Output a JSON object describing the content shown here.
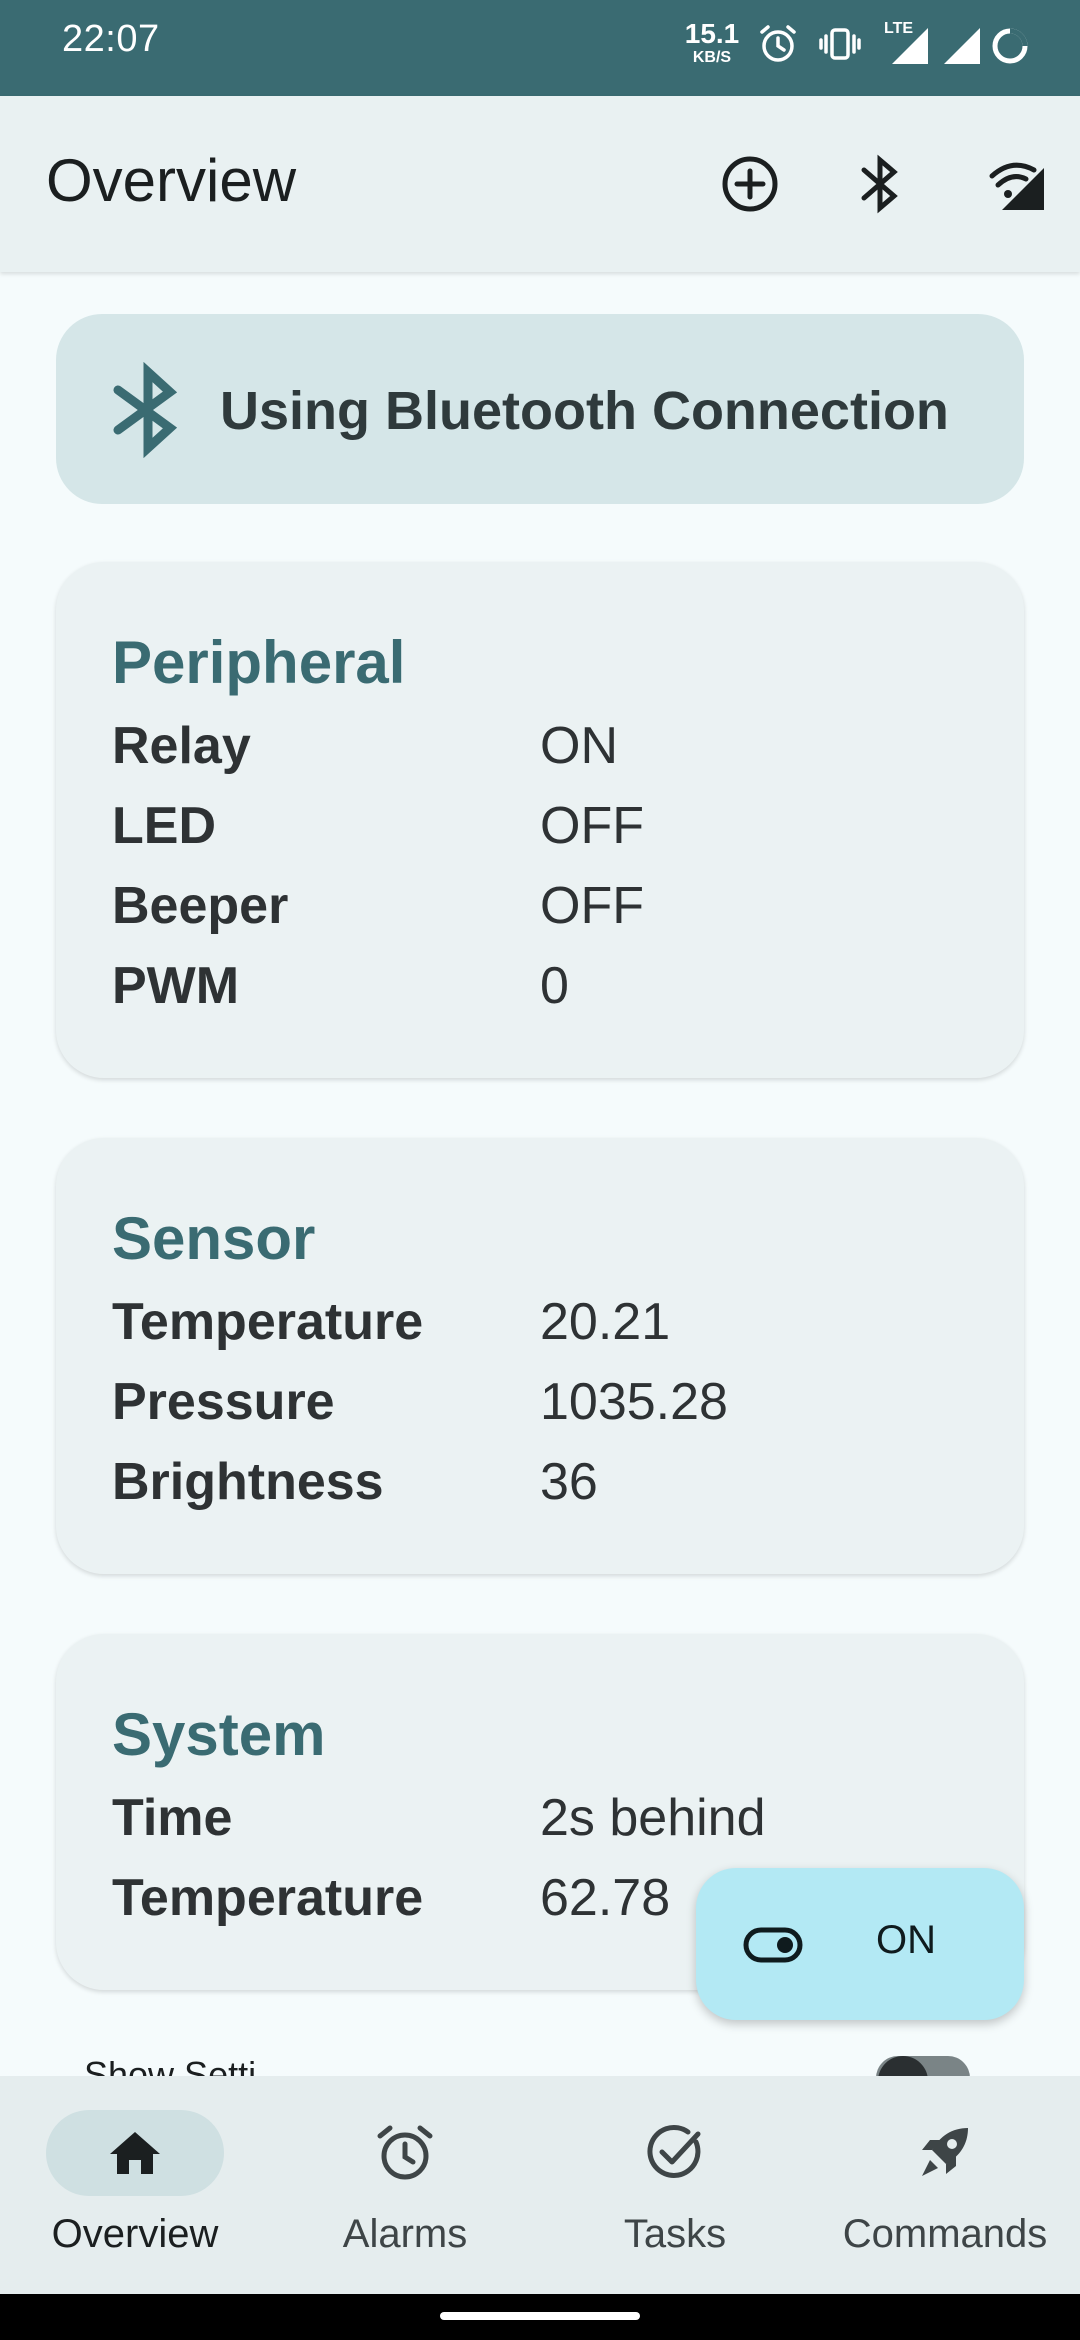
{
  "status_bar": {
    "time": "22:07",
    "speed_value": "15.1",
    "speed_unit": "KB/S",
    "network_label": "LTE"
  },
  "app_bar": {
    "title": "Overview",
    "actions": [
      "add-circle-icon",
      "bluetooth-icon",
      "wifi-signal-icon"
    ]
  },
  "banner": {
    "icon": "bluetooth-icon",
    "text": "Using Bluetooth Connection"
  },
  "peripheral": {
    "title": "Peripheral",
    "rows": [
      {
        "label": "Relay",
        "value": "ON"
      },
      {
        "label": "LED",
        "value": "OFF"
      },
      {
        "label": "Beeper",
        "value": "OFF"
      },
      {
        "label": "PWM",
        "value": "0"
      }
    ]
  },
  "sensor": {
    "title": "Sensor",
    "rows": [
      {
        "label": "Temperature",
        "value": "20.21"
      },
      {
        "label": "Pressure",
        "value": "1035.28"
      },
      {
        "label": "Brightness",
        "value": "36"
      }
    ]
  },
  "system": {
    "title": "System",
    "rows": [
      {
        "label": "Time",
        "value": "2s behind"
      },
      {
        "label": "Temperature",
        "value": "62.78"
      }
    ]
  },
  "settings_row": {
    "label": "Show Setti"
  },
  "fab": {
    "icon": "toggle-icon",
    "label": "ON"
  },
  "bottom_nav": {
    "items": [
      {
        "label": "Overview",
        "icon": "home-icon",
        "active": true
      },
      {
        "label": "Alarms",
        "icon": "alarm-icon",
        "active": false
      },
      {
        "label": "Tasks",
        "icon": "check-circle-icon",
        "active": false
      },
      {
        "label": "Commands",
        "icon": "rocket-icon",
        "active": false
      }
    ]
  },
  "colors": {
    "primary": "#3a6b72",
    "banner_bg": "#d5e6e8",
    "card_bg": "#ebf2f3",
    "fab_bg": "#b3e9f4"
  }
}
